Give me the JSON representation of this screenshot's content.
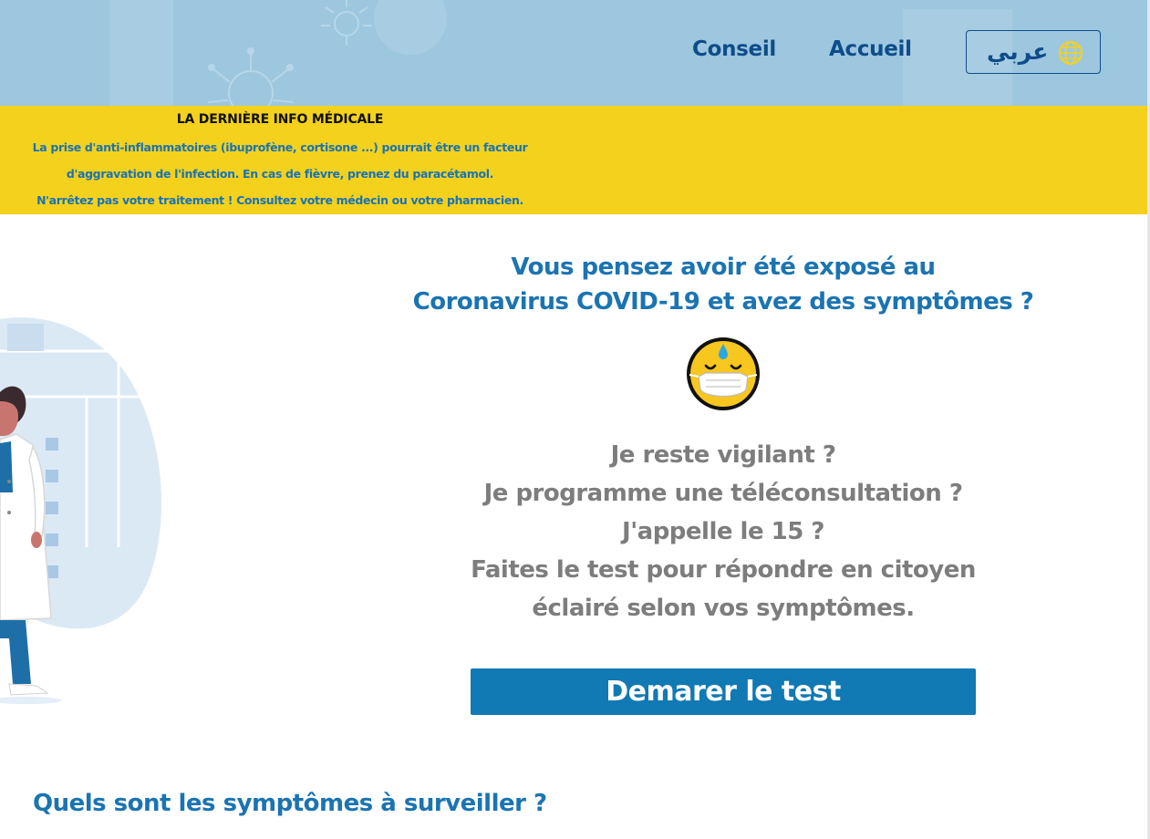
{
  "header": {
    "nav": {
      "conseil": "Conseil",
      "accueil": "Accueil"
    },
    "language_button": {
      "label": "عربي",
      "icon": "globe-icon"
    }
  },
  "info_band": {
    "title": "LA DERNIÈRE INFO MÉDICALE",
    "lines": [
      "La prise d'anti-inflammatoires (ibuprofène, cortisone ...) pourrait être un facteur",
      "d'aggravation de l'infection. En cas de fièvre, prenez du paracétamol.",
      "N'arrêtez pas votre traitement ! Consultez votre médecin ou votre pharmacien."
    ]
  },
  "hero": {
    "title_lines": [
      "Vous pensez avoir été exposé au",
      "Coronavirus COVID-19 et avez des symptômes ?"
    ],
    "emoji": "masked-face-icon",
    "questions": [
      "Je reste vigilant ?",
      "Je programme une téléconsultation ?",
      "J'appelle le 15 ?",
      "Faites le test pour répondre en citoyen",
      "éclairé selon vos symptômes."
    ],
    "start_button": "Demarer le test"
  },
  "symptoms": {
    "heading": "Quels sont les symptômes à surveiller ?"
  },
  "colors": {
    "header_bg": "#9cc7df",
    "nav_text": "#0f4c8a",
    "info_bg": "#f4d11c",
    "info_text": "#1a73b5",
    "title_blue": "#1b74b2",
    "question_gray": "#7d7d7d",
    "button_bg": "#1179b3"
  }
}
